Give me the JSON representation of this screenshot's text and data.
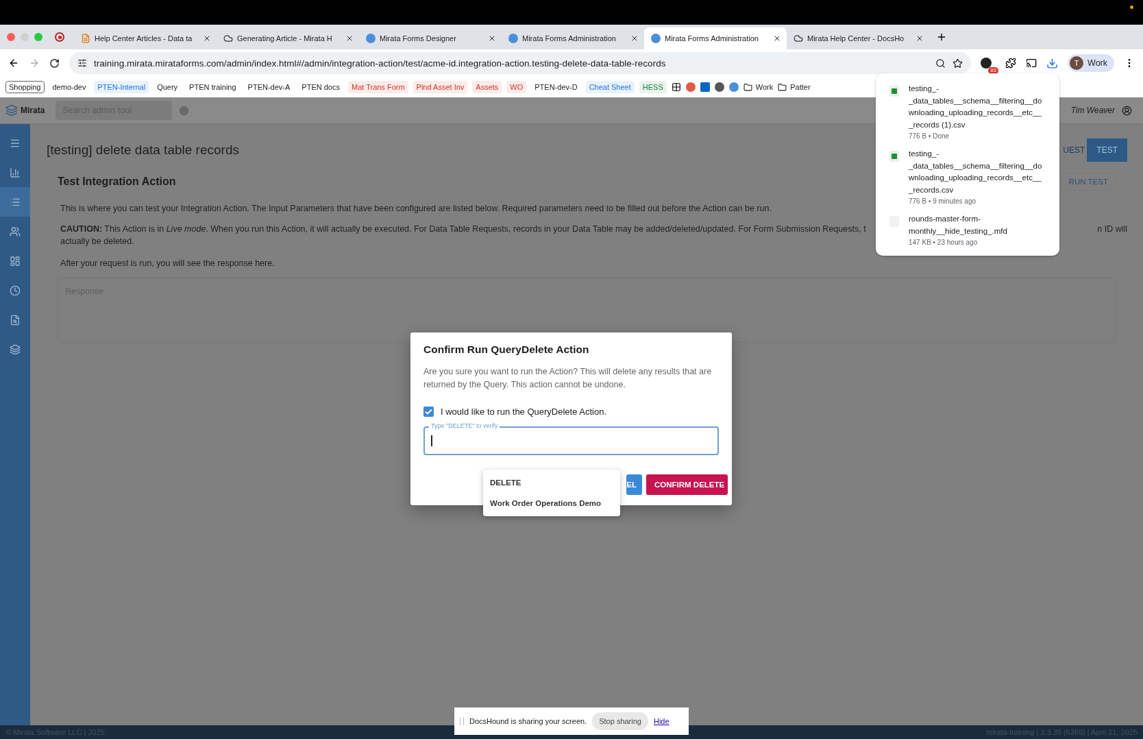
{
  "browser": {
    "tabs": [
      {
        "title": "Help Center Articles - Data ta",
        "kind": "article",
        "selected": false
      },
      {
        "title": "Generating Article - Mirata H",
        "kind": "cloud",
        "selected": false
      },
      {
        "title": "Mirata Forms Designer",
        "kind": "mirata",
        "selected": false
      },
      {
        "title": "Mirata Forms Administration",
        "kind": "mirata",
        "selected": false
      },
      {
        "title": "Mirata Forms Administration",
        "kind": "mirata",
        "selected": true
      },
      {
        "title": "Mirata Help Center - DocsHo",
        "kind": "cloud",
        "selected": false
      }
    ],
    "url": "training.mirata.mirataforms.com/admin/index.html#/admin/integration-action/test/acme-id.integration-action.testing-delete-data-table-records",
    "extension_badge": "83",
    "profile": {
      "initial": "T",
      "name": "Work"
    },
    "bookmarks": [
      {
        "label": "Shopping",
        "kind": "boxed",
        "color": "#202124"
      },
      {
        "label": "demo-dev",
        "kind": "text",
        "color": "#202124"
      },
      {
        "label": "PTEN-Internal",
        "kind": "tag",
        "color": "#1a73e8"
      },
      {
        "label": "Query",
        "kind": "text",
        "color": "#202124"
      },
      {
        "label": "PTEN training",
        "kind": "text",
        "color": "#202124"
      },
      {
        "label": "PTEN-dev-A",
        "kind": "text",
        "color": "#202124"
      },
      {
        "label": "PTEN docs",
        "kind": "text",
        "color": "#202124"
      },
      {
        "label": "Mat Trans Form",
        "kind": "tag",
        "color": "#d93025"
      },
      {
        "label": "Plnd Asset Inv",
        "kind": "tag",
        "color": "#d93025"
      },
      {
        "label": "Assets",
        "kind": "tag",
        "color": "#d93025"
      },
      {
        "label": "WO",
        "kind": "tag",
        "color": "#d93025"
      },
      {
        "label": "PTEN-dev-D",
        "kind": "text",
        "color": "#202124"
      },
      {
        "label": "Cheat Sheet",
        "kind": "tag",
        "color": "#1a73e8"
      },
      {
        "label": "HESS",
        "kind": "tag",
        "color": "#188038"
      }
    ],
    "bookmark_folders": [
      "Work",
      "Patter"
    ],
    "downloads": [
      {
        "name": "testing_-_data_tables__schema__filtering__downloading_uploading_records__etc___records (1).csv",
        "meta": "776 B • Done",
        "kind": "csv"
      },
      {
        "name": "testing_-_data_tables__schema__filtering__downloading_uploading_records__etc___records.csv",
        "meta": "776 B • 9 minutes ago",
        "kind": "csv"
      },
      {
        "name": "rounds-master-form-monthly__hide_testing_.mfd",
        "meta": "147 KB • 23 hours ago",
        "kind": "file"
      }
    ]
  },
  "app": {
    "logo": "Mirata",
    "search": {
      "placeholder": "Search admin tool"
    },
    "user": "Tim Weaver",
    "sidebar": [
      {
        "kind": "menu",
        "selected": false
      },
      {
        "kind": "chart",
        "selected": false
      },
      {
        "kind": "list",
        "selected": true
      },
      {
        "kind": "people",
        "selected": false
      },
      {
        "kind": "dashboard",
        "selected": false
      },
      {
        "kind": "clock",
        "selected": false
      },
      {
        "kind": "search",
        "selected": false
      },
      {
        "kind": "stack",
        "selected": false
      }
    ],
    "page_title": "[testing] delete data table records",
    "header_buttons": [
      {
        "label": "UEST",
        "selected": false
      },
      {
        "label": "TEST",
        "selected": true
      }
    ],
    "section_title": "Test Integration Action",
    "run_button": "RUN TEST",
    "intro": "This is where you can test your Integration Action. The Input Parameters that have been configured are listed below. Required parameters need to be filled out before the Action can be run.",
    "caution": {
      "line_1": "**CAUTION:** This Action is in *Live mode*. When you run this Action, it will actually be executed. For Data Table Requests, records in your Data Table may be added/deleted/updated. For Form Submission Requests, t",
      "line_1_end": "n ID will",
      "line_2": "actually be deleted."
    },
    "response_note": "After your request is run, you will see the response here.",
    "response": {
      "placeholder": "Response"
    },
    "footer": {
      "left": "© Mirata Software LLC | 2025",
      "right": "mirata-training | 3.3.35 (6369) | April 21, 2025"
    }
  },
  "dialog": {
    "title": "Confirm Run QueryDelete Action",
    "body": "Are you sure you want to run the Action? This will delete any results that are returned by the Query. This action cannot be undone.",
    "checkbox": {
      "label": "I would like to run the QueryDelete Action.",
      "checked": true
    },
    "field": {
      "label": "Type \"DELETE\" to verify"
    },
    "suggestions": [
      "DELETE",
      "Work Order Operations Demo"
    ],
    "cancel": "EL",
    "confirm": "CONFIRM DELETE"
  },
  "screen_share": {
    "message": "DocsHound is sharing your screen.",
    "stop": "Stop sharing",
    "hide": "Hide"
  }
}
